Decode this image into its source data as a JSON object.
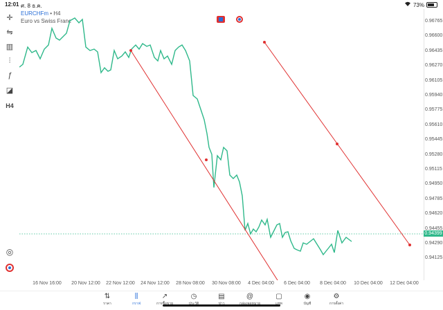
{
  "status_bar": {
    "time": "12:01",
    "date": "ศ. 8 ธ.ค.",
    "battery": "73%"
  },
  "chart": {
    "symbol": "EURCHFm",
    "timeframe": "H4",
    "description": "Euro vs Swiss Franc",
    "current_price": "0.94399",
    "price_labels": [
      "0.96765",
      "0.96600",
      "0.96435",
      "0.96270",
      "0.96105",
      "0.95940",
      "0.95775",
      "0.95610",
      "0.95445",
      "0.95280",
      "0.95115",
      "0.94950",
      "0.94785",
      "0.94620",
      "0.94455",
      "0.94290",
      "0.94125"
    ],
    "time_labels": [
      "16 Nov 16:00",
      "20 Nov 12:00",
      "22 Nov 12:00",
      "24 Nov 12:00",
      "28 Nov 08:00",
      "30 Nov 08:00",
      "4 Dec 04:00",
      "6 Dec 04:00",
      "8 Dec 04:00",
      "10 Dec 04:00",
      "12 Dec 04:00"
    ],
    "line_color": "#2eb88a",
    "trendline_color": "#e03030"
  },
  "left_toolbar": {
    "items": [
      {
        "name": "crosshair-icon",
        "glyph": "✛"
      },
      {
        "name": "indicators-icon",
        "glyph": "⇋"
      },
      {
        "name": "bar-chart-icon",
        "glyph": "▥"
      },
      {
        "name": "settings-sliders-icon",
        "glyph": "⫶"
      },
      {
        "name": "function-icon",
        "glyph": "ƒ"
      },
      {
        "name": "shapes-icon",
        "glyph": "◪"
      },
      {
        "name": "timeframe-button",
        "glyph": "H4"
      }
    ]
  },
  "bottom_tabs": [
    {
      "label": "ราคา",
      "icon": "price-icon",
      "glyph": "⇅"
    },
    {
      "label": "กราฟ",
      "icon": "chart-icon",
      "glyph": "⫼",
      "active": true
    },
    {
      "label": "การซื้อขาย",
      "icon": "trade-icon",
      "glyph": "↗"
    },
    {
      "label": "ประวัติ",
      "icon": "history-icon",
      "glyph": "◷"
    },
    {
      "label": "ข่าว",
      "icon": "news-icon",
      "glyph": "▤"
    },
    {
      "label": "กล่องจดหมาย",
      "icon": "mail-icon",
      "glyph": "@"
    },
    {
      "label": "แชท",
      "icon": "chat-icon",
      "glyph": "▢"
    },
    {
      "label": "บัญชี",
      "icon": "account-icon",
      "glyph": "◉"
    },
    {
      "label": "การตั้งค่า",
      "icon": "settings-icon",
      "glyph": "⚙"
    }
  ]
}
